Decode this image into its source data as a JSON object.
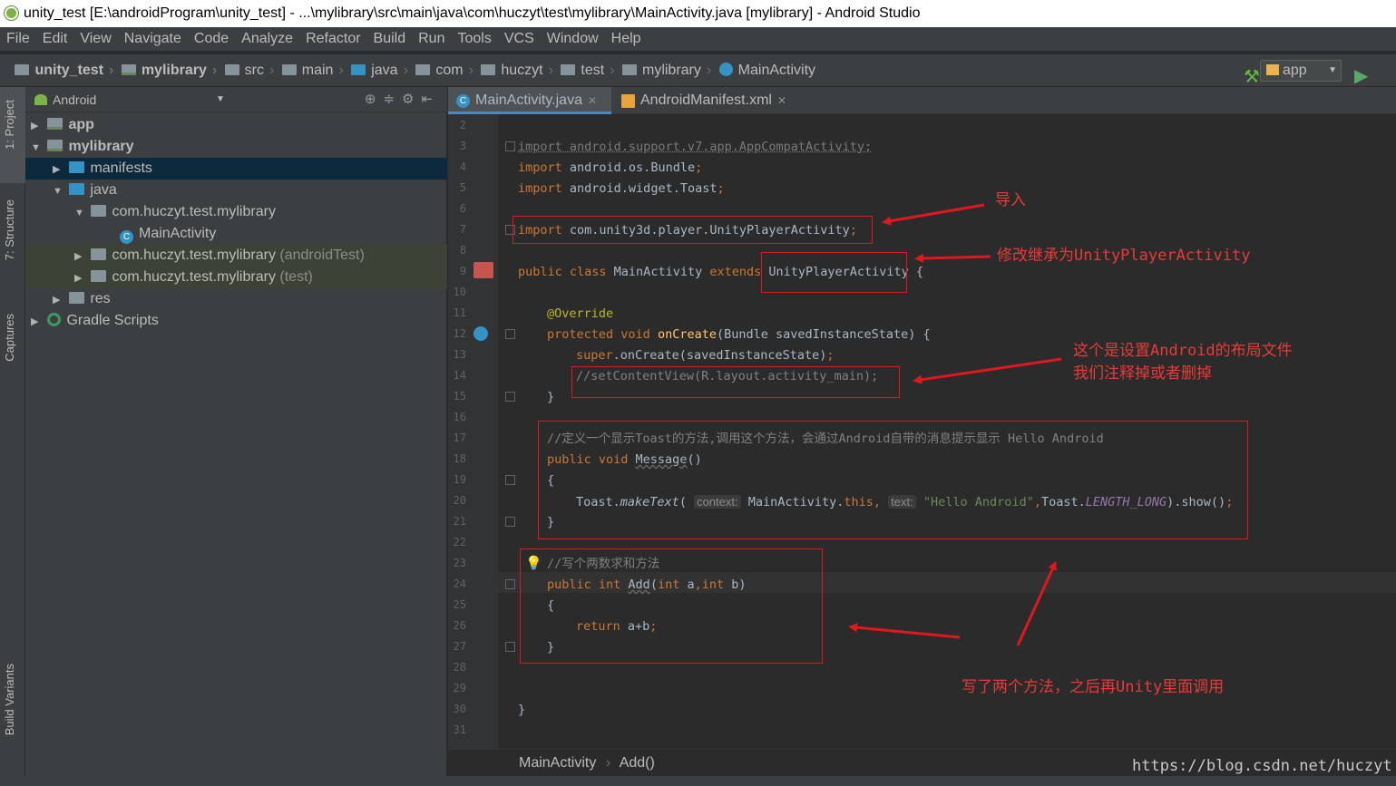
{
  "window": {
    "title": "unity_test [E:\\androidProgram\\unity_test] - ...\\mylibrary\\src\\main\\java\\com\\huczyt\\test\\mylibrary\\MainActivity.java [mylibrary] - Android Studio"
  },
  "menu": [
    "File",
    "Edit",
    "View",
    "Navigate",
    "Code",
    "Analyze",
    "Refactor",
    "Build",
    "Run",
    "Tools",
    "VCS",
    "Window",
    "Help"
  ],
  "navbar": {
    "crumbs": [
      "unity_test",
      "mylibrary",
      "src",
      "main",
      "java",
      "com",
      "huczyt",
      "test",
      "mylibrary",
      "MainActivity"
    ],
    "run_config": "app"
  },
  "left_tabs": [
    "1: Project",
    "7: Structure",
    "Captures",
    "Build Variants"
  ],
  "project_panel": {
    "view": "Android",
    "tree": [
      {
        "label": "app",
        "suffix": ""
      },
      {
        "label": "mylibrary",
        "suffix": ""
      },
      {
        "label": "manifests",
        "suffix": ""
      },
      {
        "label": "java",
        "suffix": ""
      },
      {
        "label": "com.huczyt.test.mylibrary",
        "suffix": ""
      },
      {
        "label": "MainActivity",
        "suffix": ""
      },
      {
        "label": "com.huczyt.test.mylibrary",
        "suffix": "(androidTest)"
      },
      {
        "label": "com.huczyt.test.mylibrary",
        "suffix": "(test)"
      },
      {
        "label": "res",
        "suffix": ""
      },
      {
        "label": "Gradle Scripts",
        "suffix": ""
      }
    ]
  },
  "editor": {
    "tabs": [
      "MainActivity.java",
      "AndroidManifest.xml"
    ],
    "line_numbers": [
      "2",
      "3",
      "4",
      "5",
      "6",
      "7",
      "8",
      "9",
      "10",
      "11",
      "12",
      "13",
      "14",
      "15",
      "16",
      "17",
      "18",
      "19",
      "20",
      "21",
      "22",
      "23",
      "24",
      "25",
      "26",
      "27",
      "28",
      "29",
      "30",
      "31"
    ],
    "breadcrumb": [
      "MainActivity",
      "Add()"
    ]
  },
  "annotations": {
    "import_note": "导入",
    "extends_note": "修改继承为UnityPlayerActivity",
    "layout_note_1": "这个是设置Android的布局文件",
    "layout_note_2": "我们注释掉或者删掉",
    "methods_note": "写了两个方法，之后再Unity里面调用"
  },
  "watermark": "https://blog.csdn.net/huczyt",
  "colors": {
    "annotation_red": "#e0171e",
    "keyword": "#cc7832",
    "string": "#6a8759",
    "comment": "#808080"
  }
}
